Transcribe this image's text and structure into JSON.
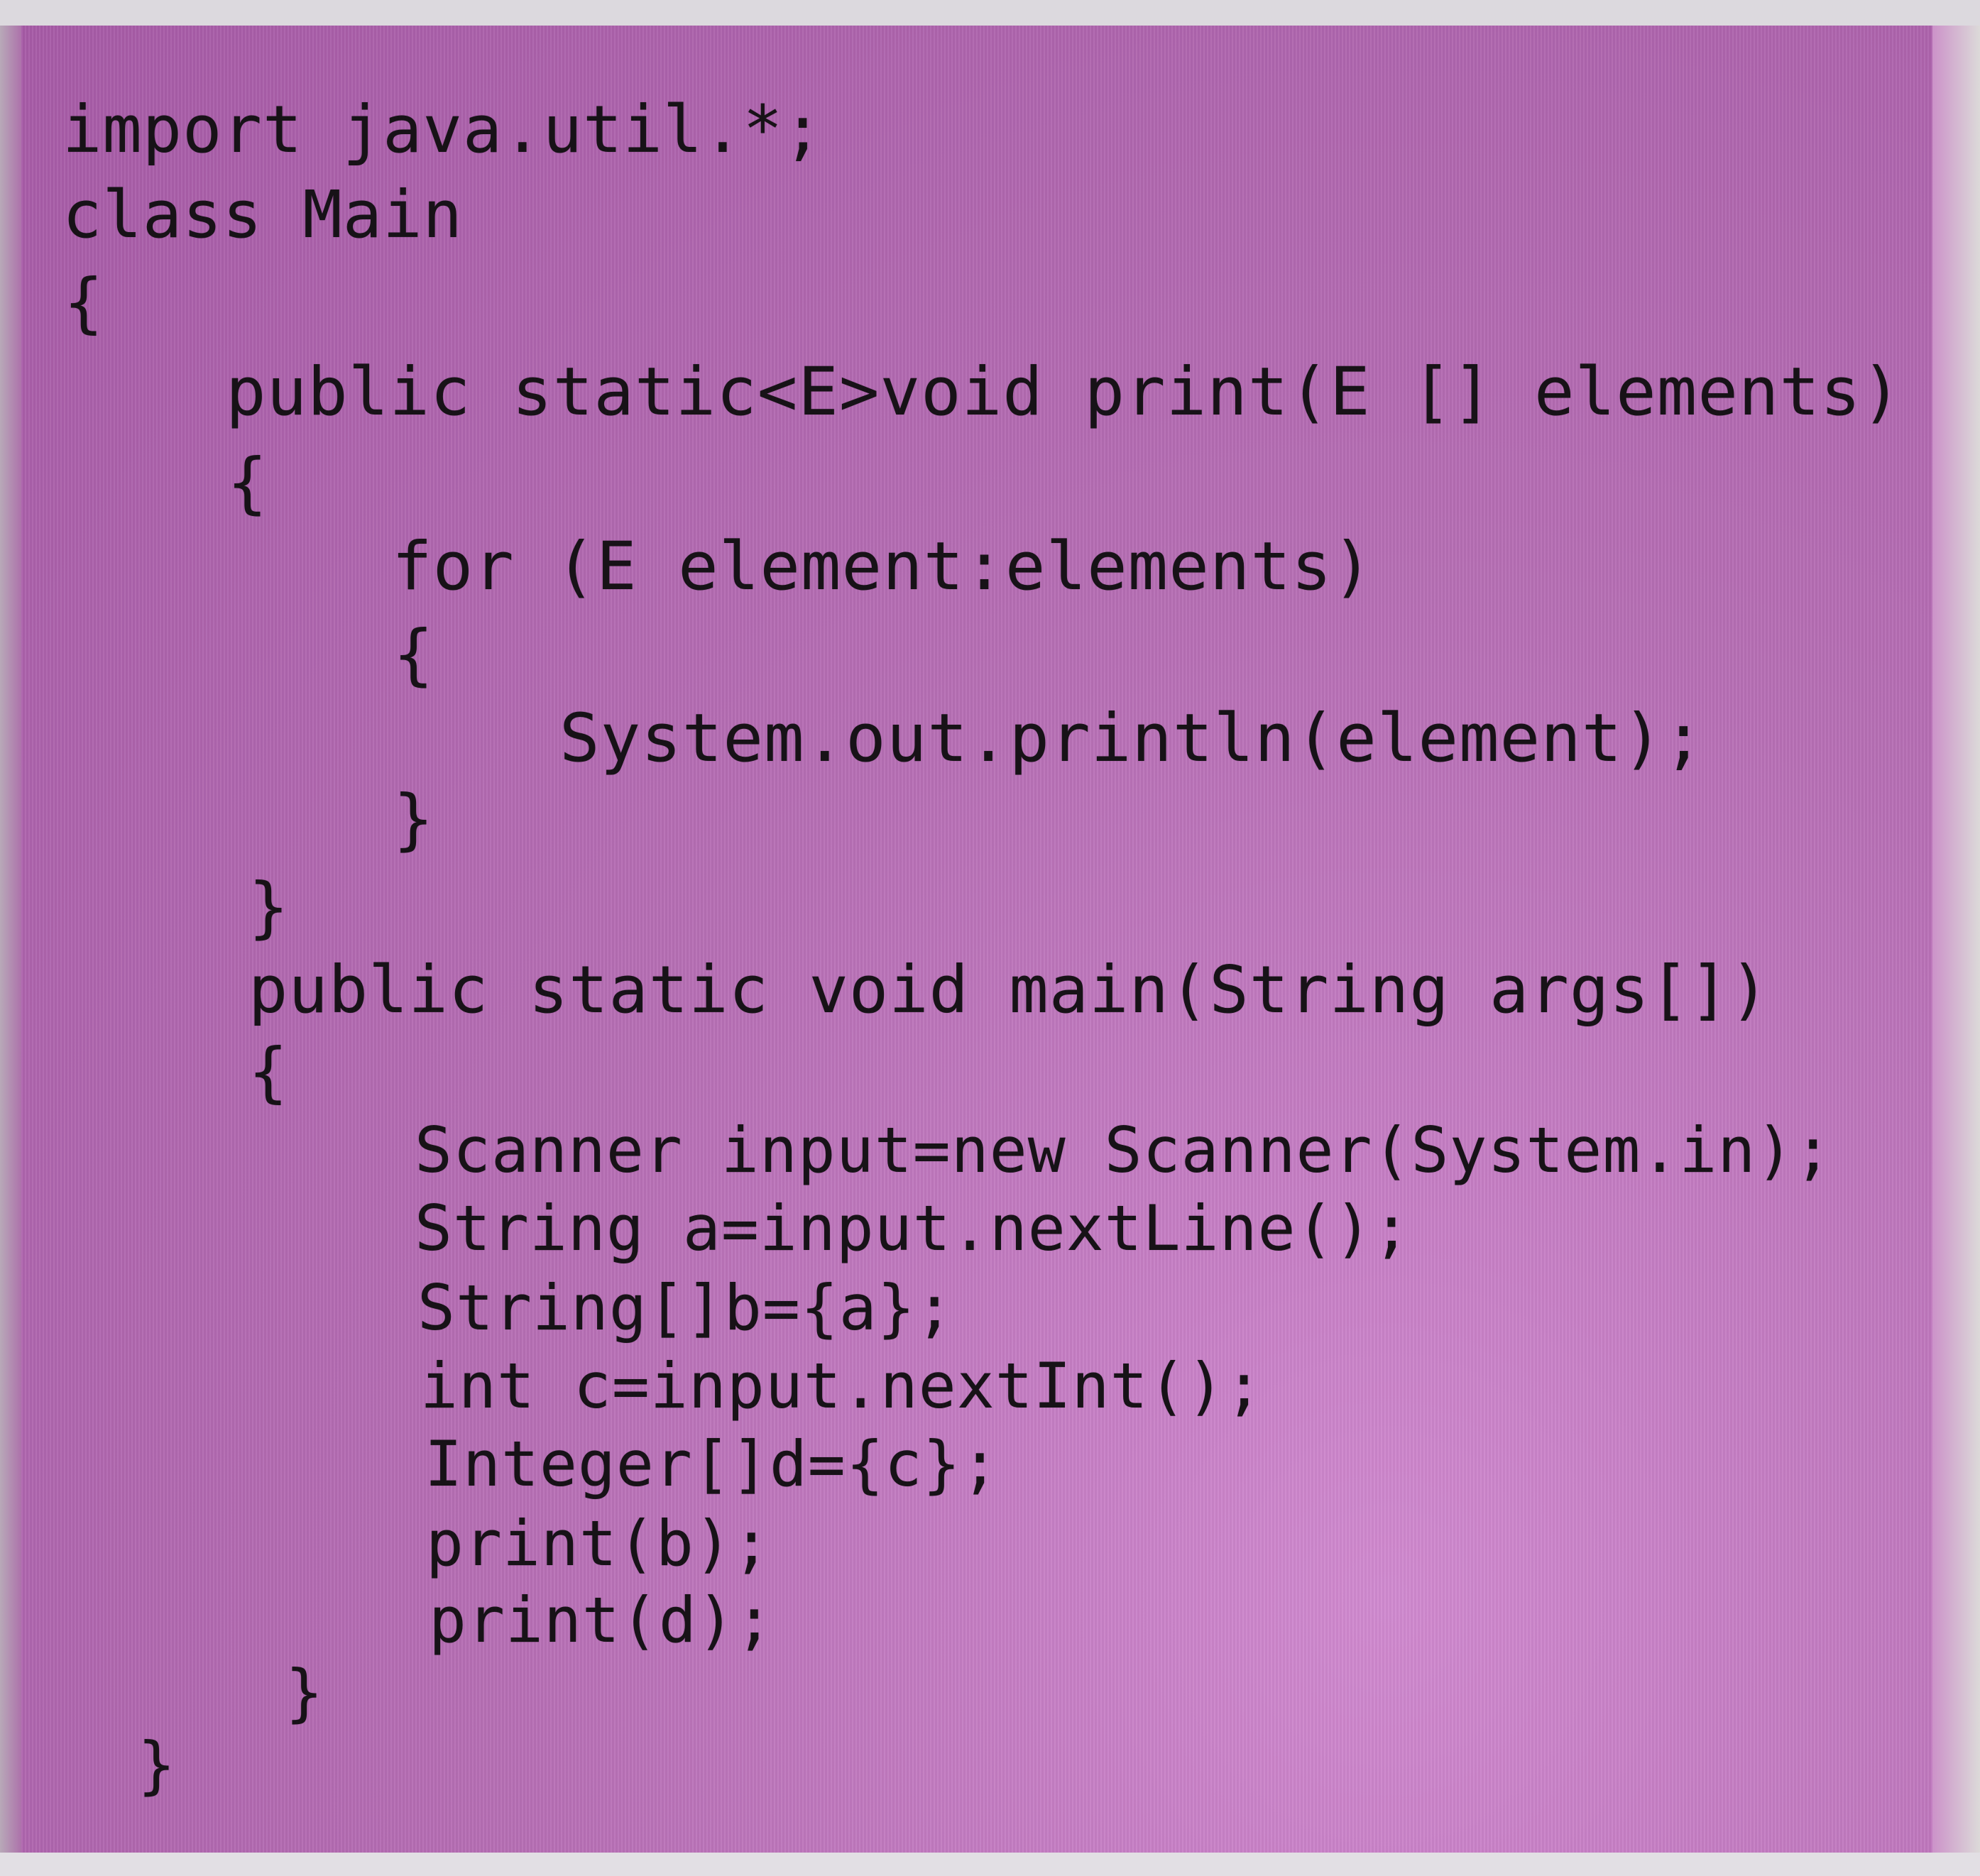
{
  "editor": {
    "lines": [
      "import java.util.*;",
      "class Main",
      "{",
      "public static<E>void print(E [] elements)",
      "{",
      "for (E element:elements)",
      "{",
      "System.out.println(element);",
      "}",
      "}",
      "public static void main(String args[])",
      "{",
      "Scanner input=new Scanner(System.in);",
      "String a=input.nextLine();",
      "String[]b={a};",
      "int c=input.nextInt();",
      "Integer[]d={c};",
      "print(b);",
      "print(d);",
      "}",
      "}"
    ]
  },
  "colors": {
    "panel_background": "#b76fb5",
    "text": "#171217",
    "screen_border": "#d9d6dc"
  }
}
